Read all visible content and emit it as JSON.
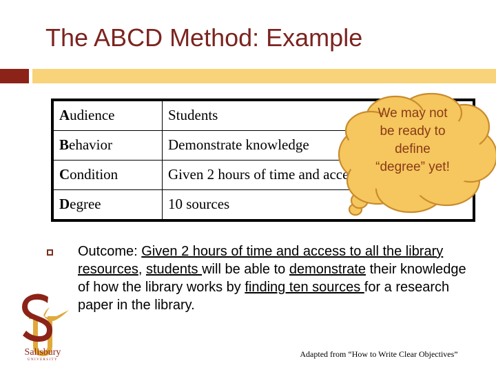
{
  "slide": {
    "title": "The ABCD Method: Example",
    "title_color": "#7B2420",
    "accent_block_color": "#8C2318",
    "accent_bar_color": "#F8D37A"
  },
  "table": {
    "rows": [
      {
        "initial": "A",
        "label_rest": "udience",
        "value": "Students"
      },
      {
        "initial": "B",
        "label_rest": "ehavior",
        "value": "Demonstrate knowledge"
      },
      {
        "initial": "C",
        "label_rest": "ondition",
        "value": "Given 2 hours of time and access"
      },
      {
        "initial": "D",
        "label_rest": "egree",
        "value": "10 sources"
      }
    ]
  },
  "bubble": {
    "fill_color": "#F5C75E",
    "stroke_color": "#C98B2E",
    "text_color": "#8A3A18",
    "lines": [
      "We may not",
      "be ready to",
      "define",
      "“degree” yet!"
    ]
  },
  "outcome": {
    "bullet_color": "#7B2E1E",
    "label": "Outcome: ",
    "segments": [
      {
        "text": "Given 2 hours of time and access to all the library resources",
        "underline": true
      },
      {
        "text": ", ",
        "underline": false
      },
      {
        "text": "students ",
        "underline": true
      },
      {
        "text": "will be able to ",
        "underline": false
      },
      {
        "text": "demonstrate",
        "underline": true
      },
      {
        "text": " their knowledge of how the library works by ",
        "underline": false
      },
      {
        "text": "finding ten sources ",
        "underline": true
      },
      {
        "text": "for a research paper in the library.",
        "underline": false
      }
    ]
  },
  "logo": {
    "s_color": "#8C2318",
    "u_color": "#E0A93C",
    "wordmark": "Salisbury",
    "subwordmark": "UNIVERSITY"
  },
  "footer": {
    "source_note": "Adapted from “How to Write Clear Objectives”"
  }
}
